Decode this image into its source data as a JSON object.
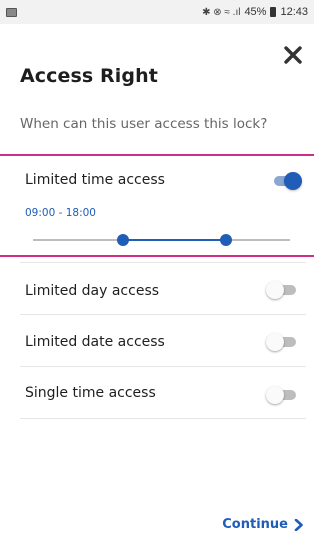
{
  "status_bar": {
    "left_icon": "image-icon",
    "glyphs": "✱ ⊗ ≈ .ıl",
    "battery_level": "45%",
    "time": "12:43"
  },
  "header": {
    "close_icon": "close-icon",
    "title": "Access Right",
    "subtitle": "When can this user access this lock?"
  },
  "options": [
    {
      "label": "Limited time access",
      "enabled": true,
      "time_range": "09:00 - 18:00",
      "slider": {
        "start": 0.35,
        "end": 0.75
      }
    },
    {
      "label": "Limited day access",
      "enabled": false
    },
    {
      "label": "Limited date access",
      "enabled": false
    },
    {
      "label": "Single time access",
      "enabled": false
    }
  ],
  "footer": {
    "continue_label": "Continue",
    "continue_icon": "chevron-right-icon"
  },
  "colors": {
    "accent": "#1f5db7",
    "highlight_border": "#cc2e8a",
    "toggle_off": "#bdbdbd"
  }
}
